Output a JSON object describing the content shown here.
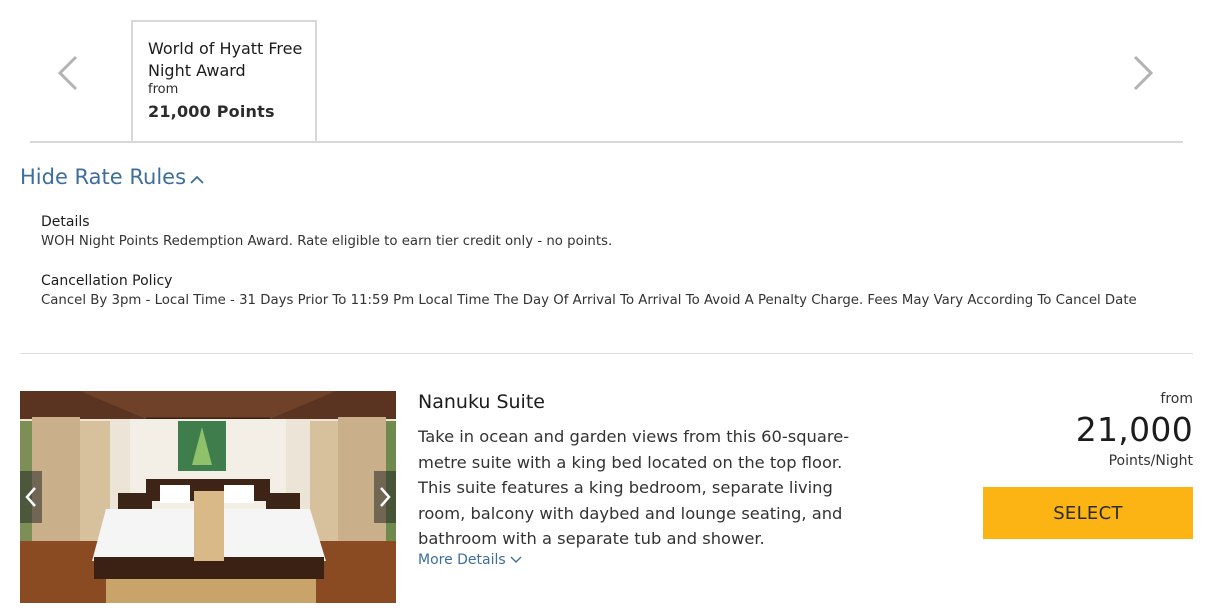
{
  "carousel": {
    "prev_icon": "chevron-left-icon",
    "next_icon": "chevron-right-icon",
    "active_tab": {
      "title": "World of Hyatt Free Night Award",
      "from_label": "from",
      "points": "21,000 Points"
    }
  },
  "rate_rules": {
    "toggle_label": "Hide Rate Rules",
    "toggle_icon": "chevron-up-icon",
    "details_heading": "Details",
    "details_text": "WOH Night Points Redemption Award. Rate eligible to earn tier credit only - no points.",
    "cancellation_heading": "Cancellation Policy",
    "cancellation_text": "Cancel By 3pm - Local Time - 31 Days Prior To 11:59 Pm Local Time The Day Of Arrival To Arrival To Avoid A Penalty Charge. Fees May Vary According To Cancel Date"
  },
  "room": {
    "name": "Nanuku Suite",
    "description": "Take in ocean and garden views from this 60-square-metre suite with a king bed located on the top floor. This suite features a king bedroom, separate living room, balcony with daybed and lounge seating, and bathroom with a separate tub and shower.",
    "more_details_label": "More Details",
    "more_details_icon": "chevron-down-icon",
    "price_from_label": "from",
    "price": "21,000",
    "price_unit": "Points/Night",
    "select_label": "SELECT",
    "select_color": "#fcb314",
    "image_prev_icon": "chevron-left-icon",
    "image_next_icon": "chevron-right-icon"
  },
  "colors": {
    "link": "#3d6e9c",
    "border": "#d8d8d8"
  }
}
